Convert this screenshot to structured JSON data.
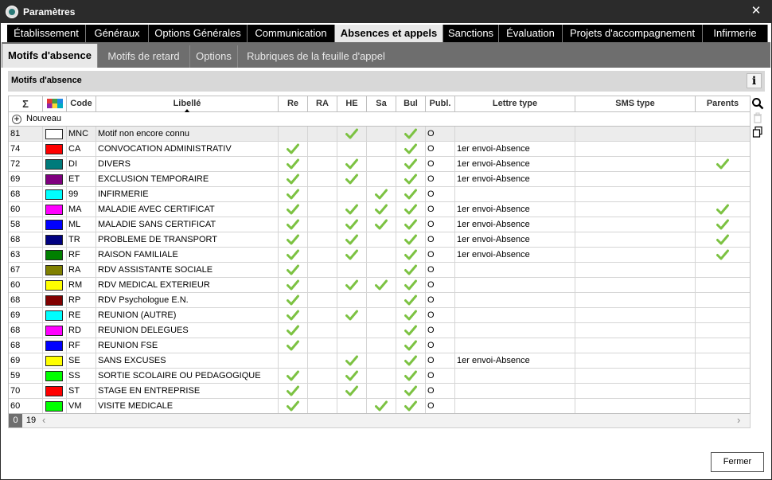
{
  "window": {
    "title": "Paramètres",
    "close_symbol": "✕",
    "icon": "pronote-icon"
  },
  "main_tabs": [
    {
      "label": "Établissement"
    },
    {
      "label": "Généraux"
    },
    {
      "label": "Options Générales"
    },
    {
      "label": "Communication"
    },
    {
      "label": "Absences et appels",
      "active": true
    },
    {
      "label": "Sanctions"
    },
    {
      "label": "Évaluation"
    },
    {
      "label": "Projets d'accompagnement"
    },
    {
      "label": "Infirmerie"
    }
  ],
  "sub_tabs": [
    {
      "label": "Motifs d'absence",
      "active": true
    },
    {
      "label": "Motifs de retard"
    },
    {
      "label": "Options"
    },
    {
      "label": "Rubriques de la feuille d'appel"
    }
  ],
  "panel": {
    "title": "Motifs d'absence",
    "info_label": "i"
  },
  "columns": {
    "sigma": "Σ",
    "color_icon": "color-palette-icon",
    "code": "Code",
    "libelle": "Libellé",
    "re": "Re",
    "ra": "RA",
    "he": "HE",
    "sa": "Sa",
    "bul": "Bul",
    "publ": "Publ.",
    "lettre": "Lettre type",
    "sms": "SMS type",
    "parents": "Parents"
  },
  "new_row_label": "Nouveau",
  "colors": {
    "check": "#7cc242",
    "header_bg": "#2b2b2b"
  },
  "rows": [
    {
      "count": "81",
      "color": "#ffffff",
      "code": "MNC",
      "libelle": "Motif non encore connu",
      "re": false,
      "ra": false,
      "he": true,
      "sa": false,
      "bul": true,
      "publ": "O",
      "lettre": "",
      "sms": "",
      "parents": false
    },
    {
      "count": "74",
      "color": "#ff0000",
      "code": "CA",
      "libelle": "CONVOCATION ADMINISTRATIV",
      "re": true,
      "ra": false,
      "he": false,
      "sa": false,
      "bul": true,
      "publ": "O",
      "lettre": "1er envoi-Absence",
      "sms": "",
      "parents": false
    },
    {
      "count": "72",
      "color": "#007b7b",
      "code": "DI",
      "libelle": "DIVERS",
      "re": true,
      "ra": false,
      "he": true,
      "sa": false,
      "bul": true,
      "publ": "O",
      "lettre": "1er envoi-Absence",
      "sms": "",
      "parents": true
    },
    {
      "count": "69",
      "color": "#800080",
      "code": "ET",
      "libelle": "EXCLUSION TEMPORAIRE",
      "re": true,
      "ra": false,
      "he": true,
      "sa": false,
      "bul": true,
      "publ": "O",
      "lettre": "1er envoi-Absence",
      "sms": "",
      "parents": false
    },
    {
      "count": "68",
      "color": "#00ffff",
      "code": "99",
      "libelle": "INFIRMERIE",
      "re": true,
      "ra": false,
      "he": false,
      "sa": true,
      "bul": true,
      "publ": "O",
      "lettre": "",
      "sms": "",
      "parents": false
    },
    {
      "count": "60",
      "color": "#ff00ff",
      "code": "MA",
      "libelle": "MALADIE AVEC CERTIFICAT",
      "re": true,
      "ra": false,
      "he": true,
      "sa": true,
      "bul": true,
      "publ": "O",
      "lettre": "1er envoi-Absence",
      "sms": "",
      "parents": true
    },
    {
      "count": "58",
      "color": "#0000ff",
      "code": "ML",
      "libelle": "MALADIE SANS CERTIFICAT",
      "re": true,
      "ra": false,
      "he": true,
      "sa": true,
      "bul": true,
      "publ": "O",
      "lettre": "1er envoi-Absence",
      "sms": "",
      "parents": true
    },
    {
      "count": "68",
      "color": "#000080",
      "code": "TR",
      "libelle": "PROBLEME DE TRANSPORT",
      "re": true,
      "ra": false,
      "he": true,
      "sa": false,
      "bul": true,
      "publ": "O",
      "lettre": "1er envoi-Absence",
      "sms": "",
      "parents": true
    },
    {
      "count": "63",
      "color": "#008000",
      "code": "RF",
      "libelle": "RAISON FAMILIALE",
      "re": true,
      "ra": false,
      "he": true,
      "sa": false,
      "bul": true,
      "publ": "O",
      "lettre": "1er envoi-Absence",
      "sms": "",
      "parents": true
    },
    {
      "count": "67",
      "color": "#808000",
      "code": "RA",
      "libelle": "RDV ASSISTANTE SOCIALE",
      "re": true,
      "ra": false,
      "he": false,
      "sa": false,
      "bul": true,
      "publ": "O",
      "lettre": "",
      "sms": "",
      "parents": false
    },
    {
      "count": "60",
      "color": "#ffff00",
      "code": "RM",
      "libelle": "RDV MEDICAL EXTERIEUR",
      "re": true,
      "ra": false,
      "he": true,
      "sa": true,
      "bul": true,
      "publ": "O",
      "lettre": "",
      "sms": "",
      "parents": false
    },
    {
      "count": "68",
      "color": "#800000",
      "code": "RP",
      "libelle": "RDV Psychologue E.N.",
      "re": true,
      "ra": false,
      "he": false,
      "sa": false,
      "bul": true,
      "publ": "O",
      "lettre": "",
      "sms": "",
      "parents": false
    },
    {
      "count": "69",
      "color": "#00ffff",
      "code": "RE",
      "libelle": "REUNION (AUTRE)",
      "re": true,
      "ra": false,
      "he": true,
      "sa": false,
      "bul": true,
      "publ": "O",
      "lettre": "",
      "sms": "",
      "parents": false
    },
    {
      "count": "68",
      "color": "#ff00ff",
      "code": "RD",
      "libelle": "REUNION DELEGUES",
      "re": true,
      "ra": false,
      "he": false,
      "sa": false,
      "bul": true,
      "publ": "O",
      "lettre": "",
      "sms": "",
      "parents": false
    },
    {
      "count": "68",
      "color": "#0000ff",
      "code": "RF",
      "libelle": "REUNION FSE",
      "re": true,
      "ra": false,
      "he": false,
      "sa": false,
      "bul": true,
      "publ": "O",
      "lettre": "",
      "sms": "",
      "parents": false
    },
    {
      "count": "69",
      "color": "#ffff00",
      "code": "SE",
      "libelle": "SANS EXCUSES",
      "re": false,
      "ra": false,
      "he": true,
      "sa": false,
      "bul": true,
      "publ": "O",
      "lettre": "1er envoi-Absence",
      "sms": "",
      "parents": false
    },
    {
      "count": "59",
      "color": "#00ff00",
      "code": "SS",
      "libelle": "SORTIE SCOLAIRE OU PEDAGOGIQUE",
      "re": true,
      "ra": false,
      "he": true,
      "sa": false,
      "bul": true,
      "publ": "O",
      "lettre": "",
      "sms": "",
      "parents": false
    },
    {
      "count": "70",
      "color": "#ff0000",
      "code": "ST",
      "libelle": "STAGE EN ENTREPRISE",
      "re": true,
      "ra": false,
      "he": true,
      "sa": false,
      "bul": true,
      "publ": "O",
      "lettre": "",
      "sms": "",
      "parents": false
    },
    {
      "count": "60",
      "color": "#00ff00",
      "code": "VM",
      "libelle": "VISITE MEDICALE",
      "re": true,
      "ra": false,
      "he": false,
      "sa": true,
      "bul": true,
      "publ": "O",
      "lettre": "",
      "sms": "",
      "parents": false
    }
  ],
  "footer": {
    "selected_count": "0",
    "total_count": "19",
    "scroll_left": "‹",
    "scroll_right": "›"
  },
  "tools": [
    "search-icon",
    "trash-icon",
    "copy-icon"
  ],
  "close_button_label": "Fermer"
}
